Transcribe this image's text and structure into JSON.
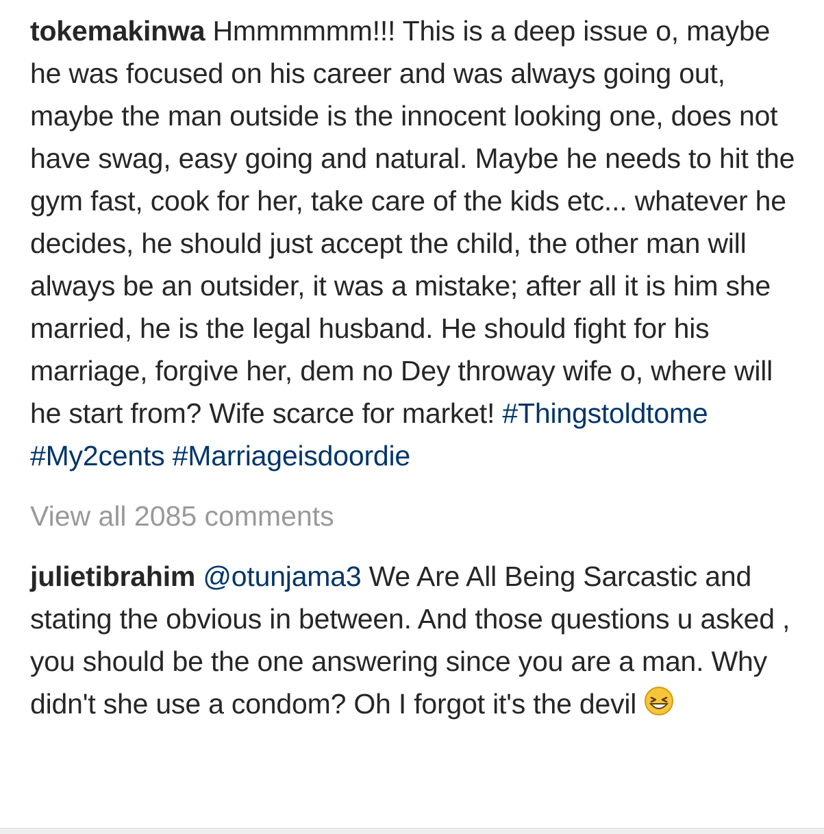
{
  "post": {
    "username": "tokemakinwa",
    "caption_text": "Hmmmmmm!!! This is a deep issue o, maybe he was focused on his career and was always going out, maybe the man outside is the innocent looking one, does not have swag, easy going and natural. Maybe he needs to hit the gym fast, cook for her, take care of the kids etc... whatever he decides, he should  just accept the child, the other man will always be an outsider, it was a mistake; after all it is him she married, he is the legal husband. He should fight for his marriage, forgive her, dem no Dey throway wife o, where will he start from? Wife scarce for market!",
    "hashtags": [
      "#Thingstoldtome",
      "#My2cents",
      "#Marriageisdoordie"
    ]
  },
  "view_all_comments": "View all 2085 comments",
  "comments": [
    {
      "username": "julietibrahim",
      "mention": "@otunjama3",
      "text": "We Are All Being Sarcastic and stating the obvious in between. And those questions u asked , you should be the one answering since you are a man. Why didn't she use a condom? Oh I forgot it's the devil",
      "emoji": "grinning-squinting-face-icon"
    }
  ]
}
